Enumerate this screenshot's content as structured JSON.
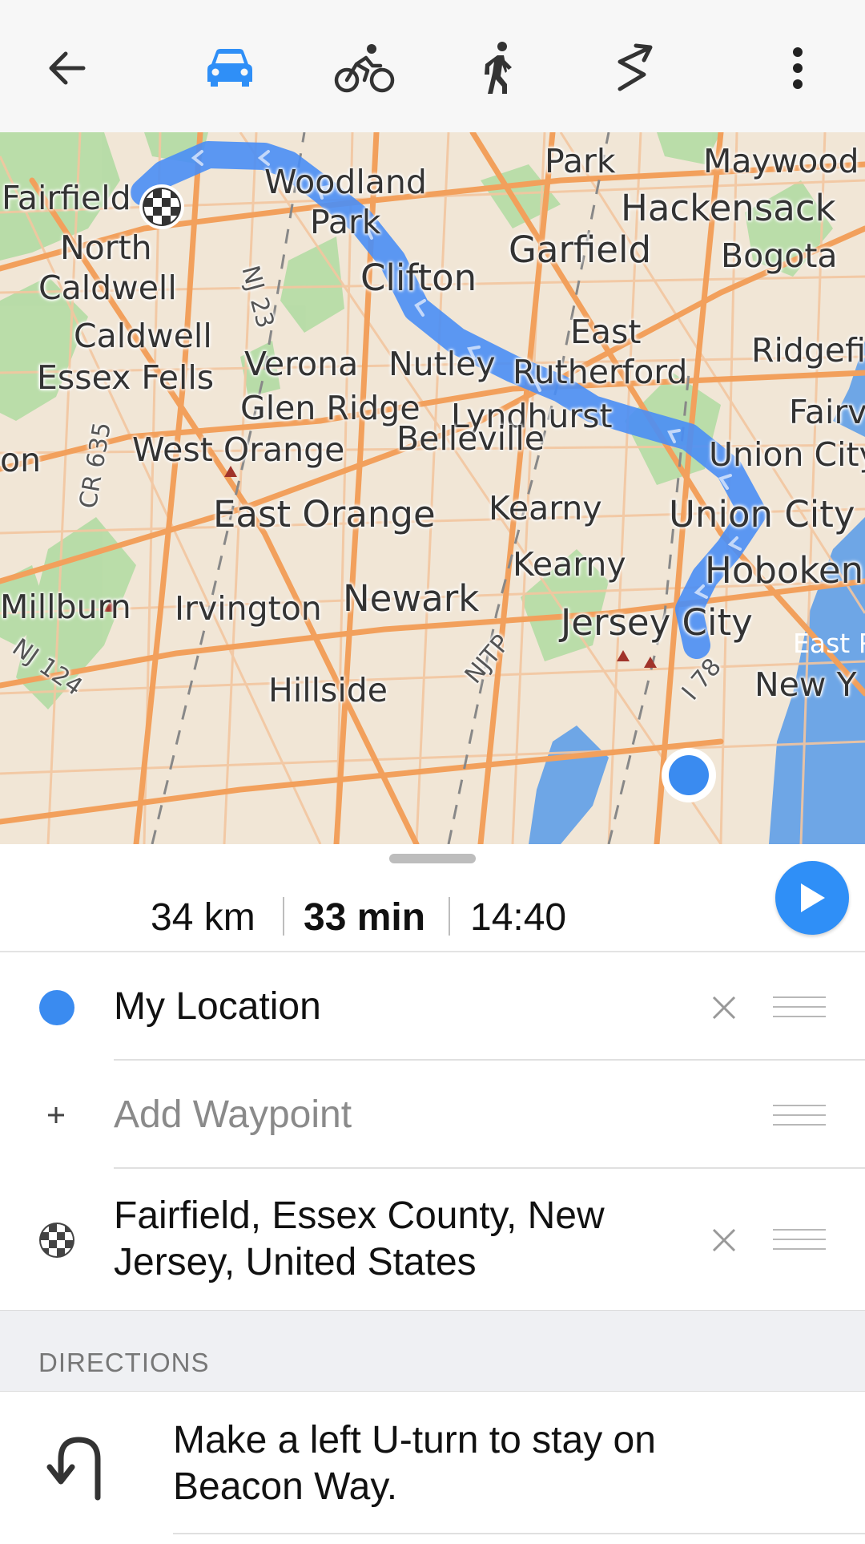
{
  "toolbar": {
    "back_icon": "arrow-left-icon",
    "modes": [
      {
        "name": "car",
        "icon": "car-icon",
        "selected": true
      },
      {
        "name": "bicycle",
        "icon": "bicycle-icon",
        "selected": false
      },
      {
        "name": "pedestrian",
        "icon": "walking-icon",
        "selected": false
      },
      {
        "name": "direct",
        "icon": "zigzag-icon",
        "selected": false
      }
    ],
    "overflow_icon": "more-vertical-icon",
    "accent_color": "#2f8ff7"
  },
  "map": {
    "route_color": "#4a8ef5",
    "labels": [
      "Fairfield",
      "Woodland",
      "Park",
      "Park",
      "Maywood",
      "Hackensack",
      "North",
      "Caldwell",
      "NJ 23",
      "Clifton",
      "Garfield",
      "Bogota",
      "Caldwell",
      "East",
      "Ridgefi",
      "Essex Fells",
      "Verona",
      "Nutley",
      "Rutherford",
      "Glen Ridge",
      "Lyndhurst",
      "Fairv",
      "on",
      "CR 635",
      "West Orange",
      "Belleville",
      "Union City",
      "East Orange",
      "Kearny",
      "Union City",
      "Kearny",
      "Hoboken",
      "Millburn",
      "Irvington",
      "Newark",
      "Jersey City",
      "NJ 124",
      "NJTP",
      "I 78",
      "East R",
      "New Y",
      "Hillside"
    ]
  },
  "summary": {
    "distance": "34 km",
    "duration": "33 min",
    "arrival": "14:40",
    "start_icon": "play-icon"
  },
  "waypoints": {
    "start": {
      "label": "My Location",
      "icon": "location-dot-icon"
    },
    "add": {
      "placeholder": "Add Waypoint",
      "icon": "plus-icon"
    },
    "destination": {
      "line1": "Fairfield, Essex County, New",
      "line2": "Jersey, United States",
      "icon": "checkered-flag-icon"
    }
  },
  "directions": {
    "header": "DIRECTIONS",
    "steps": [
      {
        "line1": "Make a left U-turn to stay on",
        "line2": "Beacon Way.",
        "icon": "u-turn-left-icon"
      }
    ]
  }
}
